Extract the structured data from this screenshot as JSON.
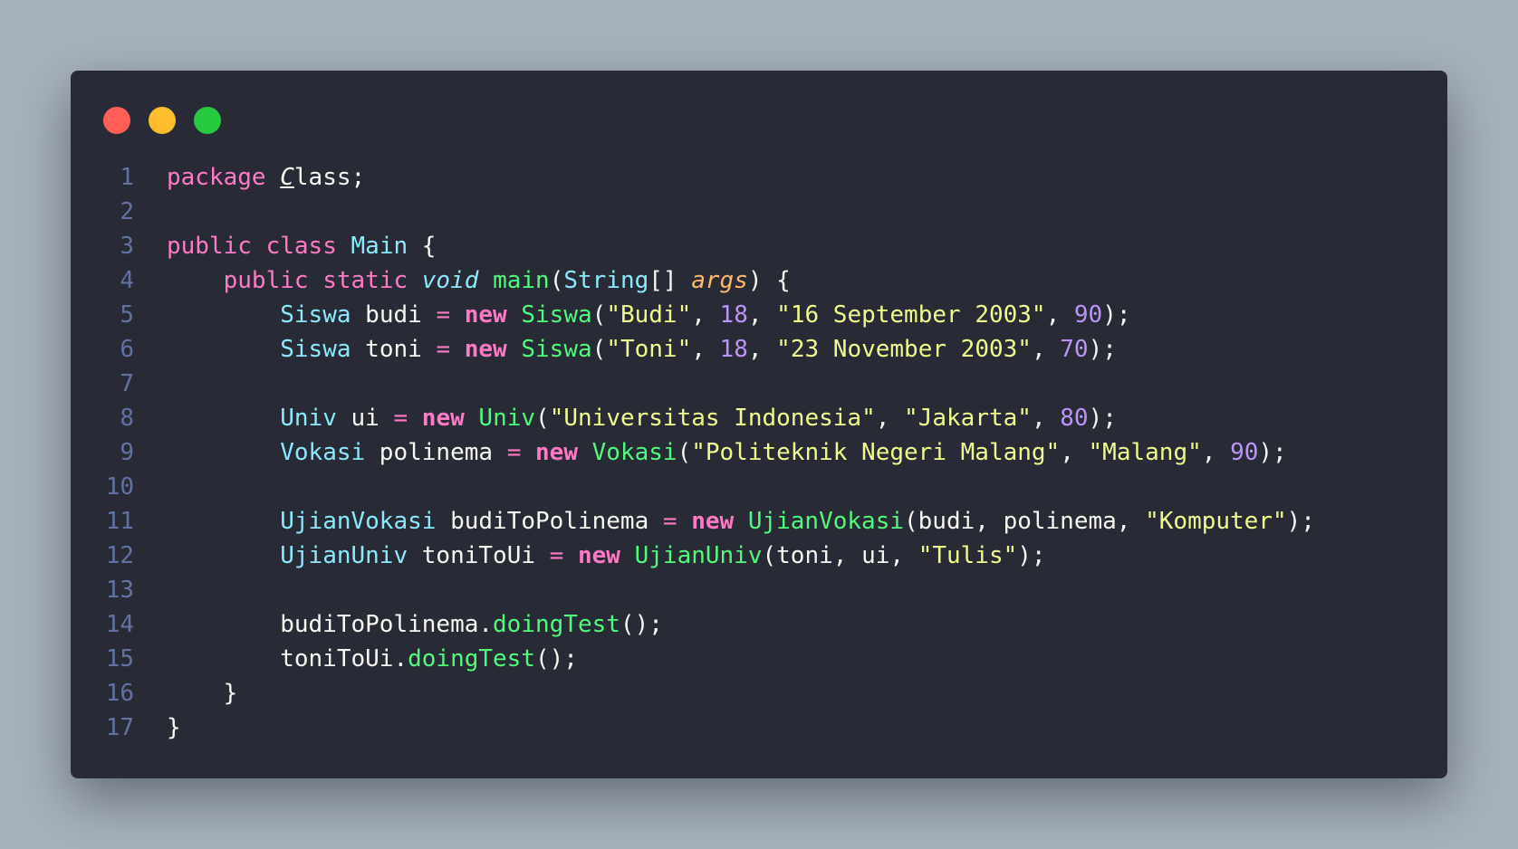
{
  "window": {
    "controls": [
      "close",
      "minimize",
      "maximize"
    ],
    "colors": {
      "close": "#ff5f56",
      "minimize": "#ffbd2e",
      "maximize": "#27c93f",
      "background": "#282a36"
    }
  },
  "code": {
    "language": "java",
    "lines": [
      [
        [
          "kw",
          "package"
        ],
        [
          "plain",
          " "
        ],
        [
          "pkgfirst",
          "C"
        ],
        [
          "pkg",
          "lass"
        ],
        [
          "plain",
          ";"
        ]
      ],
      [],
      [
        [
          "kw",
          "public"
        ],
        [
          "plain",
          " "
        ],
        [
          "kw",
          "class"
        ],
        [
          "plain",
          " "
        ],
        [
          "cls",
          "Main"
        ],
        [
          "plain",
          " {"
        ]
      ],
      [
        [
          "plain",
          "    "
        ],
        [
          "kw",
          "public"
        ],
        [
          "plain",
          " "
        ],
        [
          "kw",
          "static"
        ],
        [
          "plain",
          " "
        ],
        [
          "void",
          "void"
        ],
        [
          "plain",
          " "
        ],
        [
          "fn",
          "main"
        ],
        [
          "plain",
          "("
        ],
        [
          "cls",
          "String"
        ],
        [
          "plain",
          "[] "
        ],
        [
          "param",
          "args"
        ],
        [
          "plain",
          ") {"
        ]
      ],
      [
        [
          "plain",
          "        "
        ],
        [
          "cls",
          "Siswa"
        ],
        [
          "plain",
          " budi "
        ],
        [
          "kw",
          "="
        ],
        [
          "plain",
          " "
        ],
        [
          "kwb",
          "new"
        ],
        [
          "plain",
          " "
        ],
        [
          "fn",
          "Siswa"
        ],
        [
          "plain",
          "("
        ],
        [
          "str",
          "\"Budi\""
        ],
        [
          "plain",
          ", "
        ],
        [
          "num",
          "18"
        ],
        [
          "plain",
          ", "
        ],
        [
          "str",
          "\"16 September 2003\""
        ],
        [
          "plain",
          ", "
        ],
        [
          "num",
          "90"
        ],
        [
          "plain",
          ");"
        ]
      ],
      [
        [
          "plain",
          "        "
        ],
        [
          "cls",
          "Siswa"
        ],
        [
          "plain",
          " toni "
        ],
        [
          "kw",
          "="
        ],
        [
          "plain",
          " "
        ],
        [
          "kwb",
          "new"
        ],
        [
          "plain",
          " "
        ],
        [
          "fn",
          "Siswa"
        ],
        [
          "plain",
          "("
        ],
        [
          "str",
          "\"Toni\""
        ],
        [
          "plain",
          ", "
        ],
        [
          "num",
          "18"
        ],
        [
          "plain",
          ", "
        ],
        [
          "str",
          "\"23 November 2003\""
        ],
        [
          "plain",
          ", "
        ],
        [
          "num",
          "70"
        ],
        [
          "plain",
          ");"
        ]
      ],
      [],
      [
        [
          "plain",
          "        "
        ],
        [
          "cls",
          "Univ"
        ],
        [
          "plain",
          " ui "
        ],
        [
          "kw",
          "="
        ],
        [
          "plain",
          " "
        ],
        [
          "kwb",
          "new"
        ],
        [
          "plain",
          " "
        ],
        [
          "fn",
          "Univ"
        ],
        [
          "plain",
          "("
        ],
        [
          "str",
          "\"Universitas Indonesia\""
        ],
        [
          "plain",
          ", "
        ],
        [
          "str",
          "\"Jakarta\""
        ],
        [
          "plain",
          ", "
        ],
        [
          "num",
          "80"
        ],
        [
          "plain",
          ");"
        ]
      ],
      [
        [
          "plain",
          "        "
        ],
        [
          "cls",
          "Vokasi"
        ],
        [
          "plain",
          " polinema "
        ],
        [
          "kw",
          "="
        ],
        [
          "plain",
          " "
        ],
        [
          "kwb",
          "new"
        ],
        [
          "plain",
          " "
        ],
        [
          "fn",
          "Vokasi"
        ],
        [
          "plain",
          "("
        ],
        [
          "str",
          "\"Politeknik Negeri Malang\""
        ],
        [
          "plain",
          ", "
        ],
        [
          "str",
          "\"Malang\""
        ],
        [
          "plain",
          ", "
        ],
        [
          "num",
          "90"
        ],
        [
          "plain",
          ");"
        ]
      ],
      [],
      [
        [
          "plain",
          "        "
        ],
        [
          "cls",
          "UjianVokasi"
        ],
        [
          "plain",
          " budiToPolinema "
        ],
        [
          "kw",
          "="
        ],
        [
          "plain",
          " "
        ],
        [
          "kwb",
          "new"
        ],
        [
          "plain",
          " "
        ],
        [
          "fn",
          "UjianVokasi"
        ],
        [
          "plain",
          "(budi, polinema, "
        ],
        [
          "str",
          "\"Komputer\""
        ],
        [
          "plain",
          ");"
        ]
      ],
      [
        [
          "plain",
          "        "
        ],
        [
          "cls",
          "UjianUniv"
        ],
        [
          "plain",
          " toniToUi "
        ],
        [
          "kw",
          "="
        ],
        [
          "plain",
          " "
        ],
        [
          "kwb",
          "new"
        ],
        [
          "plain",
          " "
        ],
        [
          "fn",
          "UjianUniv"
        ],
        [
          "plain",
          "(toni, ui, "
        ],
        [
          "str",
          "\"Tulis\""
        ],
        [
          "plain",
          ");"
        ]
      ],
      [],
      [
        [
          "plain",
          "        budiToPolinema."
        ],
        [
          "fn",
          "doingTest"
        ],
        [
          "plain",
          "();"
        ]
      ],
      [
        [
          "plain",
          "        toniToUi."
        ],
        [
          "fn",
          "doingTest"
        ],
        [
          "plain",
          "();"
        ]
      ],
      [
        [
          "plain",
          "    }"
        ]
      ],
      [
        [
          "plain",
          "}"
        ]
      ]
    ]
  }
}
